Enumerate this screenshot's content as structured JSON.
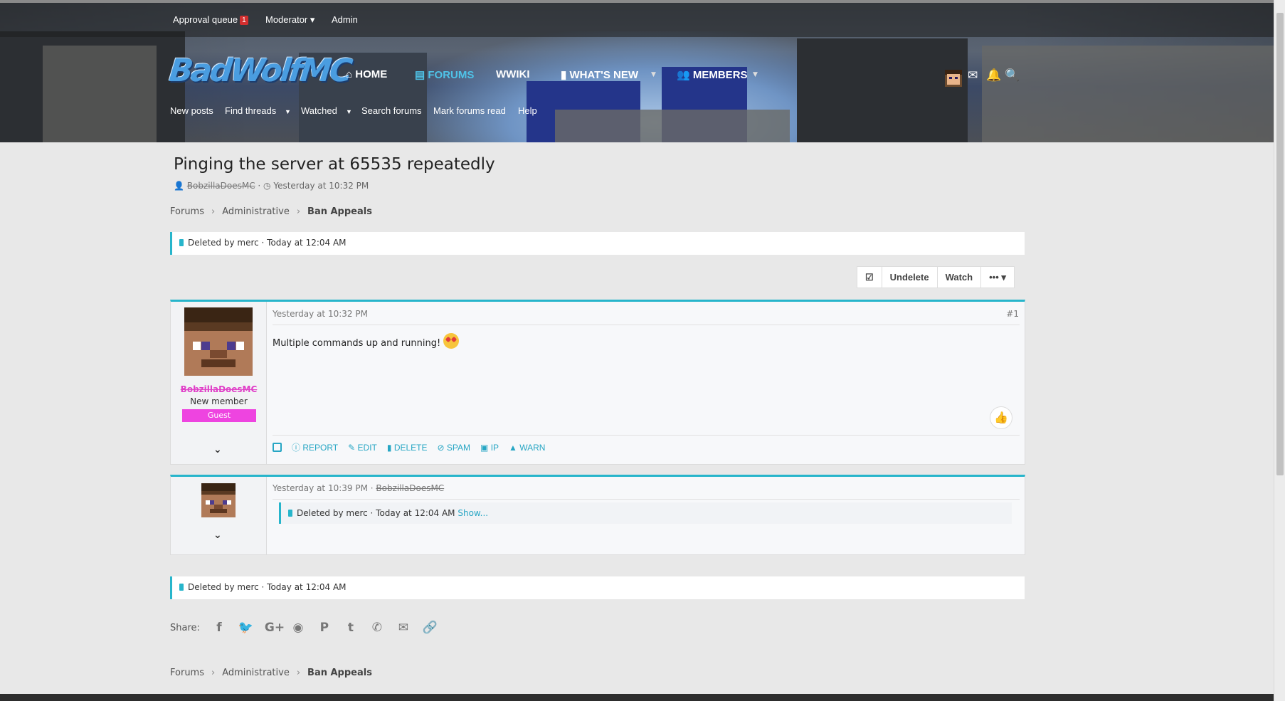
{
  "staff_bar": {
    "approval_queue": "Approval queue",
    "approval_count": "1",
    "moderator": "Moderator",
    "admin": "Admin"
  },
  "logo_text": "BadWolfMC",
  "nav": {
    "home": "HOME",
    "forums": "FORUMS",
    "wiki": "WIKI",
    "whats_new": "WHAT'S NEW",
    "members": "MEMBERS"
  },
  "subnav": [
    "New posts",
    "Find threads",
    "Watched",
    "Search forums",
    "Mark forums read",
    "Help"
  ],
  "thread": {
    "title": "Pinging the server at 65535 repeatedly",
    "author": "BobzillaDoesMC",
    "date": "Yesterday at 10:32 PM"
  },
  "breadcrumb": [
    "Forums",
    "Administrative",
    "Ban Appeals"
  ],
  "deleted_notice": "Deleted by merc · Today at 12:04 AM",
  "actions": {
    "undelete": "Undelete",
    "watch": "Watch",
    "more": "•••"
  },
  "post1": {
    "username": "BobzillaDoesMC",
    "user_title": "New member",
    "banner": "Guest",
    "date": "Yesterday at 10:32 PM",
    "number": "#1",
    "body": "Multiple commands up and running!",
    "tools": [
      "REPORT",
      "EDIT",
      "DELETE",
      "SPAM",
      "IP",
      "WARN"
    ]
  },
  "post2": {
    "date": "Yesterday at 10:39 PM",
    "author": "BobzillaDoesMC",
    "deleted_text": "Deleted by merc · Today at 12:04 AM",
    "show": "Show..."
  },
  "share_label": "Share:",
  "share_icons": [
    "facebook-icon",
    "twitter-icon",
    "google-plus-icon",
    "reddit-icon",
    "pinterest-icon",
    "tumblr-icon",
    "whatsapp-icon",
    "email-icon",
    "link-icon"
  ],
  "colors": {
    "accent": "#27b5cb",
    "guest_banner": "#ee44e0",
    "username": "#e040c8"
  }
}
